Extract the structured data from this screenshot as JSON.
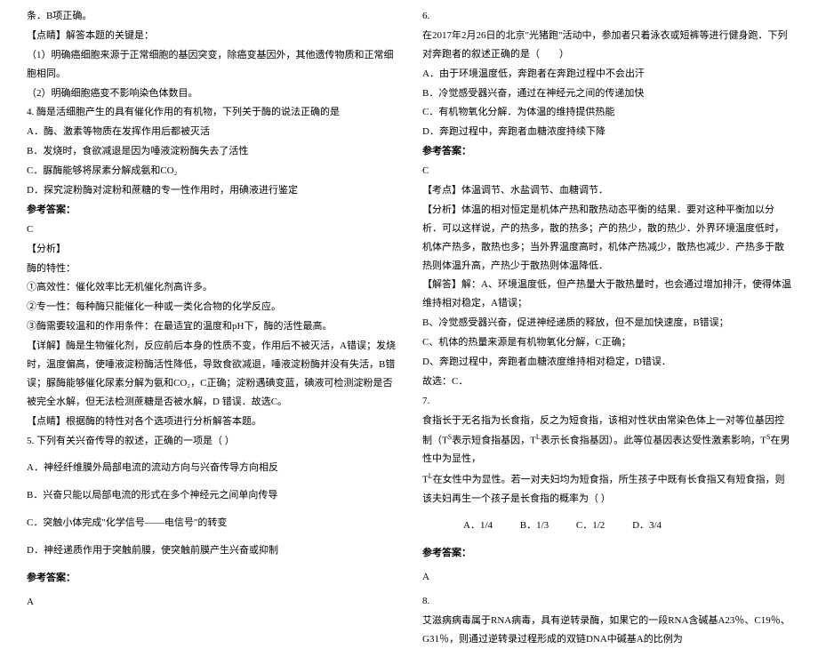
{
  "left": {
    "l1": "条．B项正确。",
    "l2": "【点睛】解答本题的关键是：",
    "l3": "（1）明确癌细胞来源于正常细胞的基因突变，除癌变基因外，其他遗传物质和正常细胞相同。",
    "l4": "（2）明确细胞癌变不影响染色体数目。",
    "l5": "4. 酶是活细胞产生的具有催化作用的有机物，下列关于酶的说法正确的是",
    "l6": "A．酶、激素等物质在发挥作用后都被灭活",
    "l7": "B．发烧时，食欲减退是因为唾液淀粉酶失去了活性",
    "l8": "C．脲酶能够将尿素分解成氨和CO₂",
    "l9": "D．探究淀粉酶对淀粉和蔗糖的专一性作用时，用碘液进行鉴定",
    "l10": "参考答案：",
    "l11": "C",
    "l12": "【分析】",
    "l13": "酶的特性：",
    "l14": "①高效性：催化效率比无机催化剂高许多。",
    "l15": "②专一性：每种酶只能催化一种或一类化合物的化学反应。",
    "l16": "③酶需要较温和的作用条件：在最适宜的温度和pH下，酶的活性最高。",
    "l17": "【详解】酶是生物催化剂，反应前后本身的性质不变，作用后不被灭活，A错误；发烧时，温度偏高，使唾液淀粉酶活性降低，导致食欲减退，唾液淀粉酶并没有失活，B错误；脲酶能够催化尿素分解为氨和CO₂，C正确；淀粉遇碘变蓝，碘液可检测淀粉是否被完全水解，但无法检测蔗糖是否被水解，D 错误．故选C。",
    "l18": "【点睛】根据酶的特性对各个选项进行分析解答本题。",
    "l19": "5. 下列有关兴奋传导的叙述，正确的一项是（      ）",
    "l20": "A．神经纤维膜外局部电流的流动方向与兴奋传导方向相反",
    "l21": "B．兴奋只能以局部电流的形式在多个神经元之间单向传导",
    "l22": "C．突触小体完成\"化学信号——电信号\"的转变",
    "l23": "D．神经递质作用于突触前膜，使突触前膜产生兴奋或抑制",
    "l24": "参考答案：",
    "l25": "A"
  },
  "right": {
    "r1": "6.",
    "r2": "在2017年2月26日的北京\"光猪跑\"活动中，参加者只着泳衣或短裤等进行健身跑．下列对奔跑者的叙述正确的是（　　）",
    "r3": "A．由于环境温度低，奔跑者在奔跑过程中不会出汗",
    "r4": "B．冷觉感受器兴奋，通过在神经元之间的传递加快",
    "r5": "C．有机物氧化分解．为体温的维持提供热能",
    "r6": "D．奔跑过程中，奔跑者血糖浓度持续下降",
    "r7": "参考答案：",
    "r8": "C",
    "r9": "【考点】体温调节、水盐调节、血糖调节．",
    "r10": "【分析】体温的相对恒定是机体产热和散热动态平衡的结果．要对这种平衡加以分析．可以这样说，产的热多，散的热多；产的热少，散的热少．外界环境温度低时，机体产热多，散热也多；当外界温度高时，机体产热减少，散热也减少．产热多于散热则体温升高，产热少于散热则体温降低．",
    "r11": "【解答】解：A、环境温度低，但产热量大于散热量时，也会通过增加排汗，使得体温维持相对稳定，A错误；",
    "r12": "B、冷觉感受器兴奋，促进神经递质的释放，但不是加快速度，B错误；",
    "r13": "C、机体的热量来源是有机物氧化分解，C正确；",
    "r14": "D、奔跑过程中，奔跑者血糖浓度维持相对稳定，D错误．",
    "r15": "故选：C．",
    "r16": "7.",
    "r17a": "食指长于无名指为长食指，反之为短食指，该相对性状由常染色体上一对等位基因控制（T",
    "r17b": "表示短食指基因，T",
    "r17c": "表示长食指基因）。此等位基因表达受性激素影响，T",
    "r17d": "在男性中为显性，",
    "r17e": "T",
    "r17f": "在女性中为显性。若一对夫妇均为短食指，所生孩子中既有长食指又有短食指，则该夫妇再生一个孩子是长食指的概率为（      ）",
    "r18a": "A．1/4",
    "r18b": "B．1/3",
    "r18c": "C．1/2",
    "r18d": "D．3/4",
    "r19": "参考答案：",
    "r20": "A",
    "r21": "8.",
    "r22": "艾滋病病毒属于RNA病毒，具有逆转录酶，如果它的一段RNA含碱基A23％、C19％、G31％，则通过逆转录过程形成的双链DNA中碱基A的比例为"
  }
}
